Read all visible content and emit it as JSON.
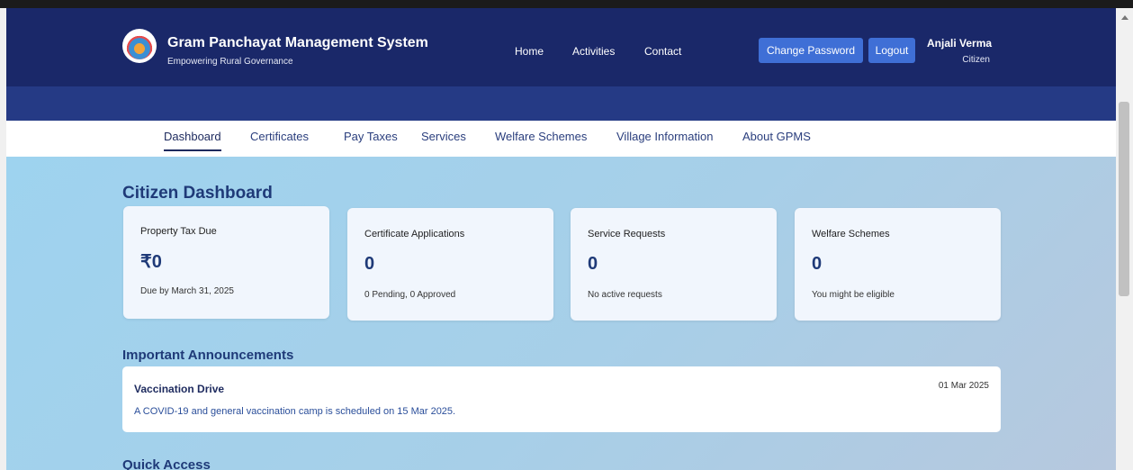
{
  "brand": {
    "title": "Gram Panchayat Management System",
    "subtitle": "Empowering Rural Governance",
    "logo_icon": "panchayat-logo-icon"
  },
  "topnav": {
    "home": "Home",
    "activities": "Activities",
    "contact": "Contact"
  },
  "actions": {
    "change_password": "Change Password",
    "logout": "Logout"
  },
  "user": {
    "name": "Anjali Verma",
    "role": "Citizen"
  },
  "subnav": {
    "items": [
      "Dashboard",
      "Certificates",
      "Pay Taxes",
      "Services",
      "Welfare Schemes",
      "Village Information",
      "About GPMS"
    ],
    "active": "Dashboard"
  },
  "dashboard": {
    "title": "Citizen Dashboard",
    "cards": [
      {
        "label": "Property Tax Due",
        "value": "₹0",
        "note": "Due by March 31, 2025"
      },
      {
        "label": "Certificate Applications",
        "value": "0",
        "note": "0 Pending, 0 Approved"
      },
      {
        "label": "Service Requests",
        "value": "0",
        "note": "No active requests"
      },
      {
        "label": "Welfare Schemes",
        "value": "0",
        "note": "You might be eligible"
      }
    ]
  },
  "announcements": {
    "title": "Important Announcements",
    "items": [
      {
        "title": "Vaccination Drive",
        "text": "A COVID-19 and general vaccination camp is scheduled on 15 Mar 2025.",
        "date": "01 Mar 2025"
      }
    ]
  },
  "quick_access": {
    "title": "Quick Access"
  },
  "colors": {
    "header": "#1a2869",
    "accent": "#3f6fd6",
    "title": "#1f3a78"
  }
}
